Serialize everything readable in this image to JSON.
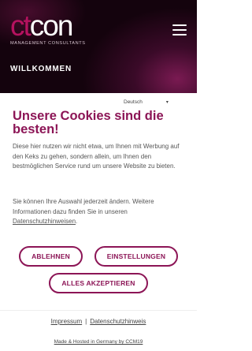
{
  "header": {
    "logo": {
      "part1": "ct",
      "part2": "con",
      "tagline": "MANAGEMENT CONSULTANTS"
    },
    "menu_icon": "hamburger-menu-icon",
    "page_title": "WILLKOMMEN"
  },
  "cookie_modal": {
    "language": "Deutsch",
    "title": "Unsere Cookies sind die besten!",
    "paragraph1": "Diese hier nutzen wir nicht etwa, um Ihnen mit Werbung auf den Keks zu gehen, sondern allein, um Ihnen den bestmöglichen Service rund um unsere Website zu bieten.",
    "paragraph2_prefix": "Sie können Ihre Auswahl jederzeit ändern. Weitere Informationen dazu finden Sie in unseren ",
    "paragraph2_link": "Datenschutzhinweisen",
    "paragraph2_suffix": ".",
    "buttons": {
      "reject": "ABLEHNEN",
      "settings": "EINSTELLUNGEN",
      "accept_all": "ALLES AKZEPTIEREN"
    }
  },
  "footer": {
    "impressum": "Impressum",
    "separator": "|",
    "privacy": "Datenschutzhinweis",
    "hosted": "Made & Hosted in Germany by CCM19"
  },
  "colors": {
    "brand": "#8c1556",
    "logo_accent": "#b5125f",
    "header_dark": "#14030d"
  }
}
